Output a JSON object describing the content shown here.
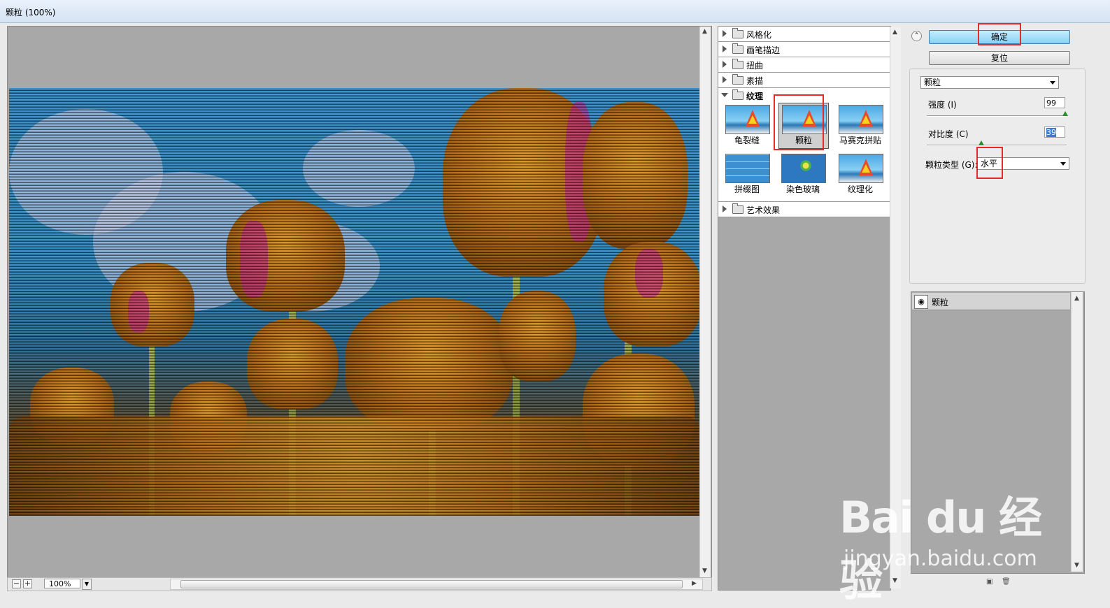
{
  "window": {
    "title": "颗粒 (100%)"
  },
  "preview": {
    "zoom": "100%",
    "zoom_out": "−",
    "zoom_in": "+"
  },
  "filter_tree": {
    "categories": [
      {
        "label": "风格化"
      },
      {
        "label": "画笔描边"
      },
      {
        "label": "扭曲"
      },
      {
        "label": "素描"
      },
      {
        "label": "纹理"
      }
    ],
    "texture_filters": [
      {
        "label": "龟裂缝"
      },
      {
        "label": "颗粒"
      },
      {
        "label": "马赛克拼贴"
      },
      {
        "label": "拼缀图"
      },
      {
        "label": "染色玻璃"
      },
      {
        "label": "纹理化"
      }
    ],
    "after_category": {
      "label": "艺术效果"
    }
  },
  "controls": {
    "collapse_glyph": "⌃",
    "ok_label": "确定",
    "reset_label": "复位",
    "filter_select": "颗粒",
    "intensity_label": "强度 (I)",
    "intensity_value": "99",
    "intensity_level": 99,
    "contrast_label": "对比度 (C)",
    "contrast_value": "39",
    "contrast_level": 39,
    "grain_type_label": "颗粒类型 (G):",
    "grain_type_value": "水平"
  },
  "layers": {
    "items": [
      {
        "label": "颗粒",
        "eye": "◉"
      }
    ]
  },
  "watermark": {
    "main": "Bai du 经验",
    "sub": "jingyan.baidu.com"
  }
}
